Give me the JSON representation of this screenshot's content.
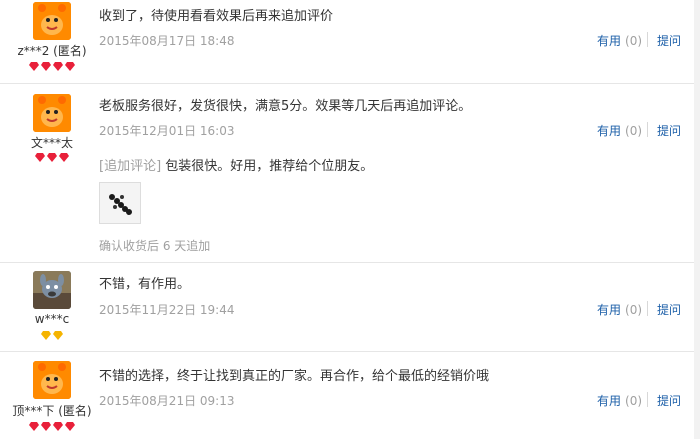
{
  "reviews": [
    {
      "user": "z***2 (匿名)",
      "content": "收到了，待使用看看效果后再来追加评价",
      "date": "2015年08月17日 18:48",
      "useful_label": "有用",
      "useful_count": "(0)",
      "ask_label": "提问",
      "badge": "red-diamond",
      "badge_count": 4
    },
    {
      "user": "文***太",
      "content": "老板服务很好，发货很快，满意5分。效果等几天后再追加评论。",
      "date": "2015年12月01日 16:03",
      "useful_label": "有用",
      "useful_count": "(0)",
      "ask_label": "提问",
      "badge": "red-diamond",
      "badge_count": 3,
      "append_tag": "[追加评论]",
      "append_content": "包装很快。好用，推荐给个位朋友。",
      "append_image": "product-photo",
      "append_note": "确认收货后 6 天追加"
    },
    {
      "user": "w***c",
      "content": "不错，有作用。",
      "date": "2015年11月22日 19:44",
      "useful_label": "有用",
      "useful_count": "(0)",
      "ask_label": "提问",
      "badge": "yellow-diamond",
      "badge_count": 2
    },
    {
      "user": "顶***下 (匿名)",
      "content": "不错的选择，终于让找到真正的厂家。再合作，给个最低的经销价哦",
      "date": "2015年08月21日 09:13",
      "useful_label": "有用",
      "useful_count": "(0)",
      "ask_label": "提问",
      "badge": "red-diamond",
      "badge_count": 4
    }
  ],
  "colors": {
    "link": "#1c5fa8",
    "muted": "#a0a0a0",
    "red_badge": "#e8203a",
    "yellow_badge": "#f5b400",
    "avatar_orange": "#ff8a00"
  }
}
